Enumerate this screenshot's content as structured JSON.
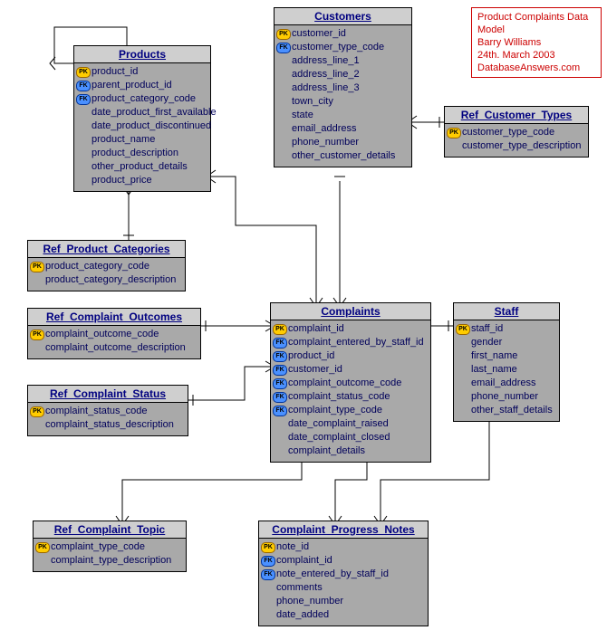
{
  "info": {
    "l1": "Product Complaints Data Model",
    "l2": "Barry Williams",
    "l3": "24th. March 2003",
    "l4": "DatabaseAnswers.com"
  },
  "key_labels": {
    "pk": "PK",
    "fk": "FK"
  },
  "entities": {
    "products": {
      "title": "Products",
      "attrs": [
        {
          "key": "pk",
          "name": "product_id"
        },
        {
          "key": "fk",
          "name": "parent_product_id"
        },
        {
          "key": "fk",
          "name": "product_category_code"
        },
        {
          "key": "",
          "name": "date_product_first_available"
        },
        {
          "key": "",
          "name": "date_product_discontinued"
        },
        {
          "key": "",
          "name": "product_name"
        },
        {
          "key": "",
          "name": "product_description"
        },
        {
          "key": "",
          "name": "other_product_details"
        },
        {
          "key": "",
          "name": "product_price"
        }
      ]
    },
    "customers": {
      "title": "Customers",
      "attrs": [
        {
          "key": "pk",
          "name": "customer_id"
        },
        {
          "key": "fk",
          "name": "customer_type_code"
        },
        {
          "key": "",
          "name": "address_line_1"
        },
        {
          "key": "",
          "name": "address_line_2"
        },
        {
          "key": "",
          "name": "address_line_3"
        },
        {
          "key": "",
          "name": "town_city"
        },
        {
          "key": "",
          "name": "state"
        },
        {
          "key": "",
          "name": "email_address"
        },
        {
          "key": "",
          "name": "phone_number"
        },
        {
          "key": "",
          "name": "other_customer_details"
        }
      ]
    },
    "ref_customer_types": {
      "title": "Ref_Customer_Types",
      "attrs": [
        {
          "key": "pk",
          "name": "customer_type_code"
        },
        {
          "key": "",
          "name": "customer_type_description"
        }
      ]
    },
    "ref_product_categories": {
      "title": "Ref_Product_Categories",
      "attrs": [
        {
          "key": "pk",
          "name": "product_category_code"
        },
        {
          "key": "",
          "name": "product_category_description"
        }
      ]
    },
    "ref_complaint_outcomes": {
      "title": "Ref_Complaint_Outcomes",
      "attrs": [
        {
          "key": "pk",
          "name": "complaint_outcome_code"
        },
        {
          "key": "",
          "name": "complaint_outcome_description"
        }
      ]
    },
    "ref_complaint_status": {
      "title": "Ref_Complaint_Status",
      "attrs": [
        {
          "key": "pk",
          "name": "complaint_status_code"
        },
        {
          "key": "",
          "name": "complaint_status_description"
        }
      ]
    },
    "complaints": {
      "title": "Complaints",
      "attrs": [
        {
          "key": "pk",
          "name": "complaint_id"
        },
        {
          "key": "fk",
          "name": "complaint_entered_by_staff_id"
        },
        {
          "key": "fk",
          "name": "product_id"
        },
        {
          "key": "fk",
          "name": "customer_id"
        },
        {
          "key": "fk",
          "name": "complaint_outcome_code"
        },
        {
          "key": "fk",
          "name": "complaint_status_code"
        },
        {
          "key": "fk",
          "name": "complaint_type_code"
        },
        {
          "key": "",
          "name": "date_complaint_raised"
        },
        {
          "key": "",
          "name": "date_complaint_closed"
        },
        {
          "key": "",
          "name": "complaint_details"
        }
      ]
    },
    "staff": {
      "title": "Staff",
      "attrs": [
        {
          "key": "pk",
          "name": "staff_id"
        },
        {
          "key": "",
          "name": "gender"
        },
        {
          "key": "",
          "name": "first_name"
        },
        {
          "key": "",
          "name": "last_name"
        },
        {
          "key": "",
          "name": "email_address"
        },
        {
          "key": "",
          "name": "phone_number"
        },
        {
          "key": "",
          "name": "other_staff_details"
        }
      ]
    },
    "ref_complaint_topic": {
      "title": "Ref_Complaint_Topic",
      "attrs": [
        {
          "key": "pk",
          "name": "complaint_type_code"
        },
        {
          "key": "",
          "name": "complaint_type_description"
        }
      ]
    },
    "complaint_progress_notes": {
      "title": "Complaint_Progress_Notes",
      "attrs": [
        {
          "key": "pk",
          "name": "note_id"
        },
        {
          "key": "fk",
          "name": "complaint_id"
        },
        {
          "key": "fk",
          "name": "note_entered_by_staff_id"
        },
        {
          "key": "",
          "name": "comments"
        },
        {
          "key": "",
          "name": "phone_number"
        },
        {
          "key": "",
          "name": "date_added"
        }
      ]
    }
  }
}
